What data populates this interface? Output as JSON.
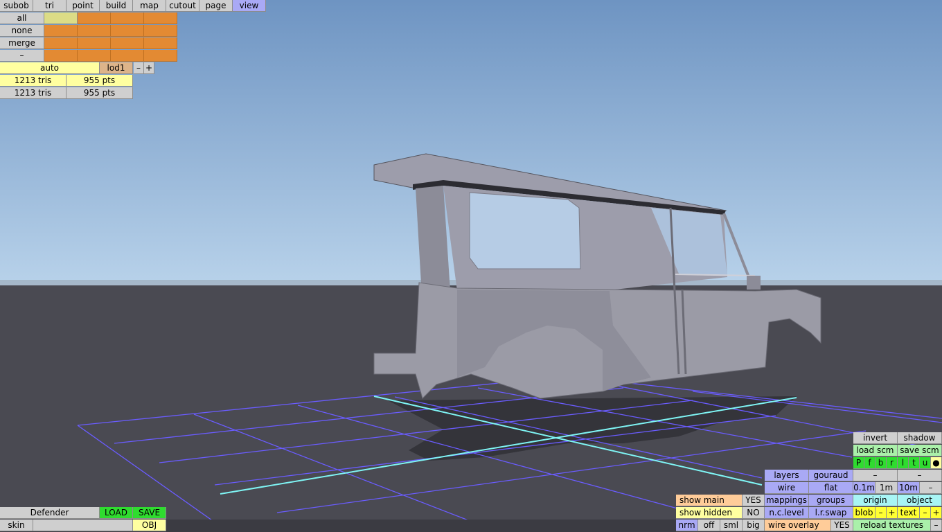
{
  "menu": {
    "tabs": [
      {
        "label": "subob",
        "active": false
      },
      {
        "label": "tri",
        "active": false
      },
      {
        "label": "point",
        "active": false
      },
      {
        "label": "build",
        "active": false
      },
      {
        "label": "map",
        "active": false
      },
      {
        "label": "cutout",
        "active": false
      },
      {
        "label": "page",
        "active": false
      },
      {
        "label": "view",
        "active": true
      }
    ]
  },
  "selection": {
    "all": "all",
    "none": "none",
    "merge": "merge",
    "minus": "–"
  },
  "lod": {
    "auto": "auto",
    "level": "lod1",
    "dec": "–",
    "inc": "+"
  },
  "stats": [
    {
      "tris": "1213 tris",
      "pts": "955 pts"
    },
    {
      "tris": "1213 tris",
      "pts": "955 pts"
    }
  ],
  "model": {
    "name": "Defender",
    "load": "LOAD",
    "save": "SAVE",
    "skin": "skin",
    "skin_value": "",
    "format": "OBJ"
  },
  "view_panel": {
    "invert": "invert",
    "shadow": "shadow",
    "load_scm": "load scm",
    "save_scm": "save scm",
    "views": [
      "P",
      "f",
      "b",
      "r",
      "l",
      "t",
      "u",
      "●"
    ],
    "minus1": "–",
    "minus2": "–",
    "layers": "layers",
    "gouraud": "gouraud",
    "wire": "wire",
    "flat": "flat",
    "mappings": "mappings",
    "groups": "groups",
    "nclevel": "n.c.level",
    "lrswap": "l.r.swap",
    "wire_overlay": "wire overlay",
    "wire_overlay_val": "YES",
    "grid_01": "0.1m",
    "grid_1": "1m",
    "grid_10": "10m",
    "grid_minus": "–",
    "origin": "origin",
    "object": "object",
    "blob": "blob",
    "blob_minus": "–",
    "blob_plus": "+",
    "text": "text",
    "text_minus": "–",
    "text_plus": "+",
    "reload": "reload textures",
    "reload_minus": "–",
    "show_main": "show main",
    "show_main_val": "YES",
    "show_hidden": "show hidden",
    "show_hidden_val": "NO",
    "nrm": "nrm",
    "off": "off",
    "sml": "sml",
    "big": "big"
  },
  "colors": {
    "sky_top": "#6e94c2",
    "sky_bottom": "#b5d0ea",
    "ground": "#4a4a52",
    "grid": "#6a5cff",
    "axis": "#7ff5f5",
    "body": "#9b9ba6"
  }
}
